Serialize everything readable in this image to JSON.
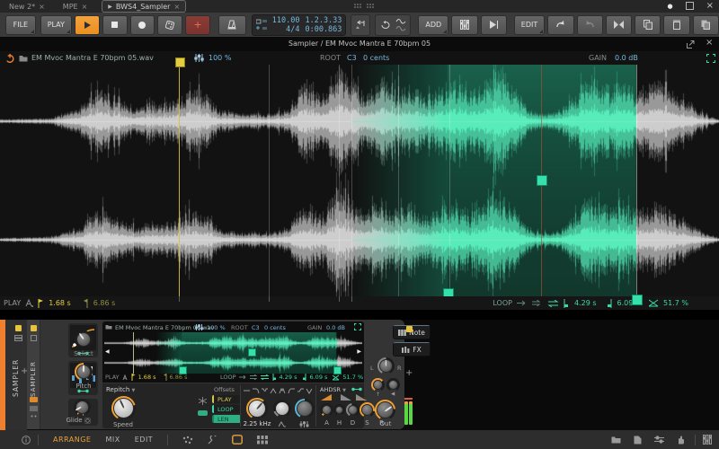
{
  "window": {
    "tabs": [
      {
        "label": "New 2*"
      },
      {
        "label": "MPE"
      },
      {
        "label": "BWS4_Sampler"
      }
    ]
  },
  "toolbar": {
    "file": "FILE",
    "play": "PLAY",
    "add": "ADD",
    "edit": "EDIT",
    "tempo": "110.00",
    "time_sig": "4/4",
    "position": "1.2.3.33",
    "time": "0:00.863"
  },
  "panel": {
    "title": "Sampler / EM Mvoc Mantra E 70bpm 05"
  },
  "editor": {
    "file_name": "EM Mvoc Mantra E 70bpm 05.wav",
    "zoom": "100 %",
    "root_label": "ROOT",
    "root_note": "C3",
    "root_cents": "0 cents",
    "gain_label": "GAIN",
    "gain_value": "0.0 dB",
    "play_label": "PLAY",
    "play_start": "1.68 s",
    "play_end": "6.86 s",
    "loop_label": "LOOP",
    "loop_start": "4.29 s",
    "loop_end": "6.09 s",
    "loop_crossfade": "51.7 %"
  },
  "device": {
    "track_name": "SAMPLER",
    "device_name": "SAMPLER",
    "add": "+",
    "select_label": "Select",
    "pitch_label": "Pitch",
    "glide_label": "Glide",
    "mode": "Repitch",
    "speed_label": "Speed",
    "offsets_label": "Offsets",
    "offsets": [
      {
        "label": "PLAY"
      },
      {
        "label": "LOOP"
      },
      {
        "label": "LEN"
      }
    ],
    "cutoff": "2.25 kHz",
    "env_label": "AHDSR",
    "env_knobs": [
      {
        "label": "A"
      },
      {
        "label": "H"
      },
      {
        "label": "D"
      },
      {
        "label": "S"
      },
      {
        "label": "R"
      }
    ],
    "note_label": "Note",
    "fx_label": "FX",
    "pan_l": "L",
    "pan_r": "R",
    "out_label": "Out"
  },
  "statusbar": {
    "views": [
      {
        "label": "ARRANGE"
      },
      {
        "label": "MIX"
      },
      {
        "label": "EDIT"
      }
    ]
  },
  "waveform": {
    "envelope": [
      [
        0,
        0.03
      ],
      [
        0.07,
        0.05
      ],
      [
        0.11,
        0.22
      ],
      [
        0.135,
        0.5
      ],
      [
        0.155,
        0.42
      ],
      [
        0.175,
        0.3
      ],
      [
        0.19,
        0.22
      ],
      [
        0.21,
        0.3
      ],
      [
        0.225,
        0.27
      ],
      [
        0.245,
        0.33
      ],
      [
        0.26,
        0.45
      ],
      [
        0.275,
        0.52
      ],
      [
        0.29,
        0.38
      ],
      [
        0.305,
        0.18
      ],
      [
        0.33,
        0.13
      ],
      [
        0.36,
        0.12
      ],
      [
        0.385,
        0.14
      ],
      [
        0.4,
        0.2
      ],
      [
        0.415,
        0.5
      ],
      [
        0.425,
        0.64
      ],
      [
        0.435,
        0.55
      ],
      [
        0.447,
        0.42
      ],
      [
        0.46,
        0.68
      ],
      [
        0.472,
        0.86
      ],
      [
        0.485,
        0.72
      ],
      [
        0.497,
        0.56
      ],
      [
        0.508,
        0.44
      ],
      [
        0.52,
        0.62
      ],
      [
        0.532,
        0.7
      ],
      [
        0.545,
        0.52
      ],
      [
        0.557,
        0.46
      ],
      [
        0.57,
        0.64
      ],
      [
        0.582,
        0.5
      ],
      [
        0.594,
        0.4
      ],
      [
        0.606,
        0.48
      ],
      [
        0.62,
        0.6
      ],
      [
        0.632,
        0.68
      ],
      [
        0.645,
        0.55
      ],
      [
        0.657,
        0.46
      ],
      [
        0.67,
        0.62
      ],
      [
        0.682,
        0.74
      ],
      [
        0.695,
        0.84
      ],
      [
        0.707,
        0.66
      ],
      [
        0.717,
        0.5
      ],
      [
        0.727,
        0.32
      ],
      [
        0.737,
        0.18
      ],
      [
        0.75,
        0.13
      ],
      [
        0.763,
        0.12
      ],
      [
        0.775,
        0.16
      ],
      [
        0.788,
        0.26
      ],
      [
        0.8,
        0.44
      ],
      [
        0.812,
        0.6
      ],
      [
        0.825,
        0.72
      ],
      [
        0.838,
        0.6
      ],
      [
        0.85,
        0.52
      ],
      [
        0.862,
        0.64
      ],
      [
        0.875,
        0.56
      ],
      [
        0.887,
        0.5
      ],
      [
        0.9,
        0.6
      ],
      [
        0.912,
        0.66
      ],
      [
        0.925,
        0.55
      ],
      [
        0.937,
        0.46
      ],
      [
        0.95,
        0.36
      ],
      [
        0.962,
        0.26
      ],
      [
        0.975,
        0.15
      ],
      [
        0.988,
        0.07
      ],
      [
        1,
        0.03
      ]
    ],
    "main": {
      "play_start": 0.249,
      "cf_start": 0.489,
      "loop_start": 0.6225,
      "cf_mid": 0.752,
      "loop_end": 0.885,
      "slices": [
        0.374,
        0.471,
        0.489,
        0.554,
        0.625
      ]
    },
    "mini": {
      "play_start": 0.11,
      "cf_start": 0.2,
      "loop_start": 0.3,
      "cf_mid": 0.57,
      "loop_end": 0.9,
      "slices": []
    },
    "colors": {
      "teal": "#4fe8b4",
      "gray": "#cfcfcf",
      "yellow": "#e3cd3f",
      "loop_fill": "#1db385"
    }
  }
}
